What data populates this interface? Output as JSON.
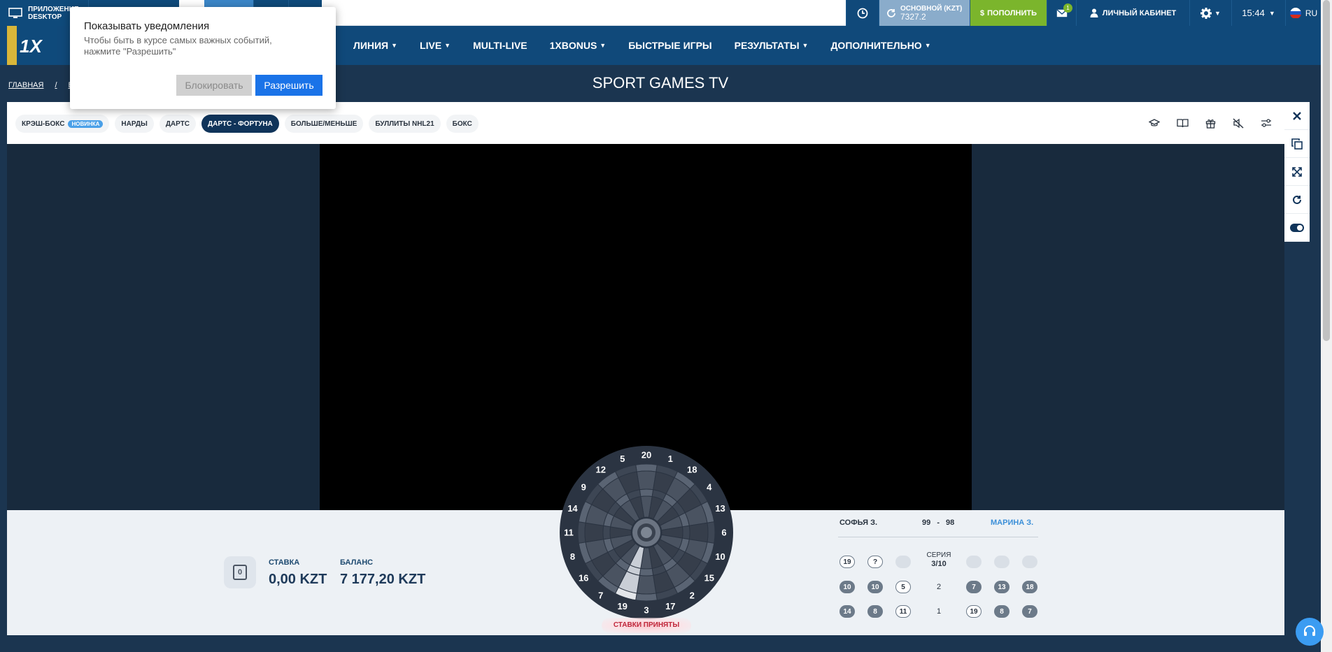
{
  "topbar": {
    "app_line1": "ПРИЛОЖЕНИЕ",
    "app_line2": "DESKTOP",
    "account_label": "ОСНОВНОЙ (KZT)",
    "account_value": "7327.2",
    "deposit_label": "ПОПОЛНИТЬ",
    "messages_badge": "1",
    "cabinet_label": "ЛИЧНЫЙ КАБИНЕТ",
    "time": "15:44",
    "lang": "RU"
  },
  "nav": {
    "logo_text": "1X",
    "items": [
      {
        "label": "ЛИНИЯ",
        "dropdown": true
      },
      {
        "label": "LIVE",
        "dropdown": true
      },
      {
        "label": "MULTI-LIVE",
        "dropdown": false
      },
      {
        "label": "1XBONUS",
        "dropdown": true
      },
      {
        "label": "БЫСТРЫЕ ИГРЫ",
        "dropdown": false
      },
      {
        "label": "РЕЗУЛЬТАТЫ",
        "dropdown": true
      },
      {
        "label": "ДОПОЛНИТЕЛЬНО",
        "dropdown": true
      }
    ]
  },
  "breadcrumb": [
    "ГЛАВНАЯ",
    "/",
    "БЫ"
  ],
  "page_title": "SPORT GAMES TV",
  "tabs": [
    {
      "label": "КРЭШ-БОКС",
      "badge": "НОВИНКА",
      "active": false
    },
    {
      "label": "НАРДЫ",
      "active": false
    },
    {
      "label": "ДАРТС",
      "active": false
    },
    {
      "label": "ДАРТС - ФОРТУНА",
      "active": true
    },
    {
      "label": "БОЛЬШЕ/МЕНЬШЕ",
      "active": false
    },
    {
      "label": "БУЛЛИТЫ NHL21",
      "active": false
    },
    {
      "label": "БОКС",
      "active": false
    }
  ],
  "stake": {
    "coin_value": "0",
    "stake_label": "СТАВКА",
    "stake_value": "0,00 KZT",
    "balance_label": "БАЛАНС",
    "balance_value": "7 177,20 KZT"
  },
  "dartboard": {
    "numbers": [
      "20",
      "1",
      "18",
      "4",
      "13",
      "6",
      "10",
      "15",
      "2",
      "17",
      "3",
      "19",
      "7",
      "16",
      "8",
      "11",
      "14",
      "9",
      "12",
      "5"
    ],
    "status": "СТАВКИ ПРИНЯТЫ"
  },
  "match": {
    "player1": "СОФЬЯ З.",
    "player2": "МАРИНА З.",
    "score1": "99",
    "score_sep": "-",
    "score2": "98",
    "series_label": "СЕРИЯ",
    "series_value": "3/10",
    "rows": [
      {
        "p1": [
          {
            "v": "19",
            "t": "o"
          },
          {
            "v": "?",
            "t": "o"
          },
          {
            "v": "",
            "t": "e"
          }
        ],
        "mid": "",
        "p2": [
          {
            "v": "",
            "t": "e"
          },
          {
            "v": "",
            "t": "e"
          },
          {
            "v": "",
            "t": "e"
          }
        ]
      },
      {
        "p1": [
          {
            "v": "10",
            "t": "f"
          },
          {
            "v": "10",
            "t": "f"
          },
          {
            "v": "5",
            "t": "o"
          }
        ],
        "mid": "2",
        "p2": [
          {
            "v": "7",
            "t": "f"
          },
          {
            "v": "13",
            "t": "f"
          },
          {
            "v": "18",
            "t": "f"
          }
        ]
      },
      {
        "p1": [
          {
            "v": "14",
            "t": "f"
          },
          {
            "v": "8",
            "t": "f"
          },
          {
            "v": "11",
            "t": "o"
          }
        ],
        "mid": "1",
        "p2": [
          {
            "v": "19",
            "t": "o"
          },
          {
            "v": "8",
            "t": "f"
          },
          {
            "v": "7",
            "t": "f"
          }
        ]
      }
    ]
  },
  "popup": {
    "title": "Показывать уведомления",
    "description": "Чтобы быть в курсе самых важных событий, нажмите \"Разрешить\"",
    "block_label": "Блокировать",
    "allow_label": "Разрешить"
  },
  "colors": {
    "brand_dark": "#10497a",
    "accent_green": "#7bb52c",
    "player2_blue": "#3b8fd8"
  }
}
